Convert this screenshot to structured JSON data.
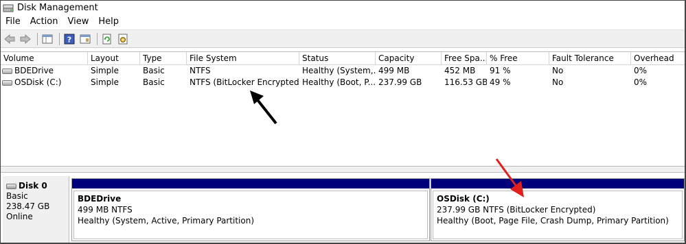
{
  "window": {
    "title": "Disk Management"
  },
  "menu": [
    "File",
    "Action",
    "View",
    "Help"
  ],
  "toolbar": {
    "icons": [
      "back-arrow-icon",
      "forward-arrow-icon",
      "console-tree-icon",
      "help-icon",
      "properties-icon",
      "refresh-icon",
      "settings-icon"
    ]
  },
  "volumes": {
    "columns": [
      "Volume",
      "Layout",
      "Type",
      "File System",
      "Status",
      "Capacity",
      "Free Spa...",
      "% Free",
      "Fault Tolerance",
      "Overhead"
    ],
    "rows": [
      {
        "volume": "BDEDrive",
        "layout": "Simple",
        "type": "Basic",
        "fs": "NTFS",
        "status": "Healthy (System,...",
        "capacity": "499 MB",
        "free": "452 MB",
        "pct_free": "91 %",
        "fault": "No",
        "overhead": "0%"
      },
      {
        "volume": "OSDisk (C:)",
        "layout": "Simple",
        "type": "Basic",
        "fs": "NTFS (BitLocker Encrypted)",
        "status": "Healthy (Boot, P...",
        "capacity": "237.99 GB",
        "free": "116.53 GB",
        "pct_free": "49 %",
        "fault": "No",
        "overhead": "0%"
      }
    ]
  },
  "disk": {
    "name": "Disk 0",
    "type": "Basic",
    "size": "238.47 GB",
    "state": "Online",
    "partitions": [
      {
        "name": "BDEDrive",
        "size_fs": "499 MB NTFS",
        "status": "Healthy (System, Active, Primary Partition)"
      },
      {
        "name": "OSDisk  (C:)",
        "size_fs": "237.99 GB NTFS (BitLocker Encrypted)",
        "status": "Healthy (Boot, Page File, Crash Dump, Primary Partition)"
      }
    ]
  },
  "colors": {
    "partition_bar": "#00007a",
    "annotation_red": "#e0201c",
    "annotation_black": "#000000"
  }
}
